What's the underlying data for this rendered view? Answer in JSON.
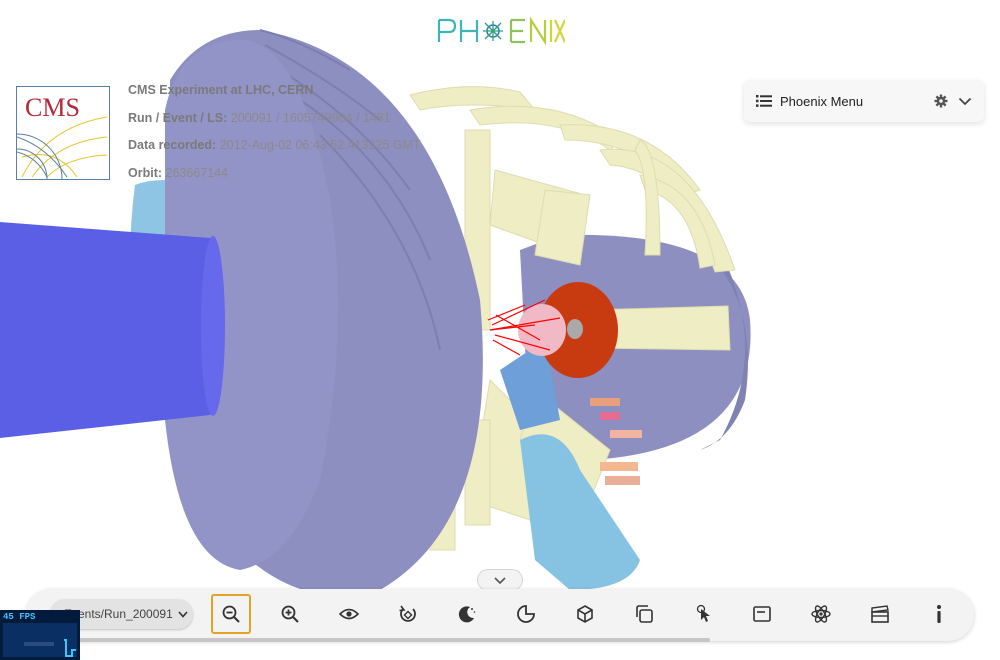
{
  "app": {
    "logo_name": "PHOENIX"
  },
  "experiment": {
    "logo_text": "CMS",
    "info": [
      {
        "label": "CMS Experiment at LHC, CERN",
        "value": ""
      },
      {
        "label": "Run / Event / LS:",
        "value": "200091 / 1605749984 / 1481"
      },
      {
        "label": "Data recorded:",
        "value": "2012-Aug-02 06:43:52.413225 GMT"
      },
      {
        "label": "Orbit:",
        "value": "263667144"
      }
    ]
  },
  "menu": {
    "label": "Phoenix Menu",
    "icons": [
      "list-icon",
      "gear-icon",
      "chevron-down-icon"
    ]
  },
  "toolbar": {
    "event_select_value": "Events/Run_200091",
    "buttons": [
      {
        "name": "zoom-out-button",
        "icon": "zoom-out-icon",
        "active": true
      },
      {
        "name": "zoom-in-button",
        "icon": "zoom-in-icon",
        "active": false
      },
      {
        "name": "view-options-button",
        "icon": "eye-icon",
        "active": false
      },
      {
        "name": "auto-rotate-button",
        "icon": "rotate-icon",
        "active": false
      },
      {
        "name": "dark-theme-button",
        "icon": "moon-icon",
        "active": false
      },
      {
        "name": "cartesian-grid-button",
        "icon": "quarter-circle-icon",
        "active": false
      },
      {
        "name": "overlay-button",
        "icon": "cube-icon",
        "active": false
      },
      {
        "name": "clipping-button",
        "icon": "copy-icon",
        "active": false
      },
      {
        "name": "object-selection-button",
        "icon": "pointer-icon",
        "active": false
      },
      {
        "name": "info-panel-button",
        "icon": "panel-icon",
        "active": false
      },
      {
        "name": "event-data-explorer-button",
        "icon": "atom-icon",
        "active": false
      },
      {
        "name": "animate-button",
        "icon": "clapperboard-icon",
        "active": false
      },
      {
        "name": "info-button",
        "icon": "info-icon",
        "active": false
      }
    ]
  },
  "stats": {
    "text": "45 FPS"
  },
  "colors": {
    "background": "#ffffff",
    "endcap": "#8d8fc1",
    "beampipe": "#5b5fe6",
    "muon": "#eeedc4",
    "calorimeter": "#c83a10",
    "tracks": "#ff0000",
    "active_border": "#e3a325"
  }
}
